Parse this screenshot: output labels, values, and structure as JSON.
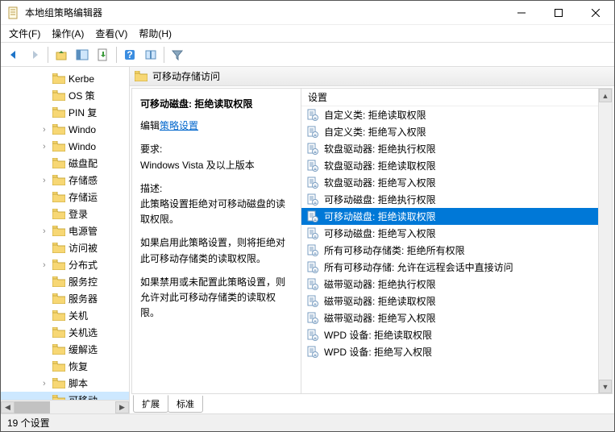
{
  "window": {
    "title": "本地组策略编辑器"
  },
  "menu": {
    "file": "文件(F)",
    "action": "操作(A)",
    "view": "查看(V)",
    "help": "帮助(H)"
  },
  "tree": {
    "items": [
      {
        "label": "Kerbe"
      },
      {
        "label": "OS 策"
      },
      {
        "label": "PIN 复"
      },
      {
        "label": "Windo",
        "toggle": true
      },
      {
        "label": "Windo",
        "toggle": true
      },
      {
        "label": "磁盘配"
      },
      {
        "label": "存储感",
        "toggle": true
      },
      {
        "label": "存储运"
      },
      {
        "label": "登录"
      },
      {
        "label": "电源管",
        "toggle": true
      },
      {
        "label": "访问被"
      },
      {
        "label": "分布式",
        "toggle": true
      },
      {
        "label": "服务控"
      },
      {
        "label": "服务器"
      },
      {
        "label": "关机"
      },
      {
        "label": "关机选"
      },
      {
        "label": "缓解选"
      },
      {
        "label": "恢复"
      },
      {
        "label": "脚本",
        "toggle": true
      },
      {
        "label": "可移动",
        "selected": true
      }
    ]
  },
  "header": {
    "title": "可移动存储访问"
  },
  "desc": {
    "title": "可移动磁盘: 拒绝读取权限",
    "edit_prefix": "编辑",
    "edit_link": "策略设置",
    "req_label": "要求:",
    "req_body": "Windows Vista 及以上版本",
    "desc_label": "描述:",
    "desc_body": "此策略设置拒绝对可移动磁盘的读取权限。",
    "p2": "如果启用此策略设置，则将拒绝对此可移动存储类的读取权限。",
    "p3": "如果禁用或未配置此策略设置，则允许对此可移动存储类的读取权限。"
  },
  "list": {
    "col": "设置",
    "items": [
      {
        "label": "自定义类: 拒绝读取权限"
      },
      {
        "label": "自定义类: 拒绝写入权限"
      },
      {
        "label": "软盘驱动器: 拒绝执行权限"
      },
      {
        "label": "软盘驱动器: 拒绝读取权限"
      },
      {
        "label": "软盘驱动器: 拒绝写入权限"
      },
      {
        "label": "可移动磁盘: 拒绝执行权限"
      },
      {
        "label": "可移动磁盘: 拒绝读取权限",
        "selected": true
      },
      {
        "label": "可移动磁盘: 拒绝写入权限"
      },
      {
        "label": "所有可移动存储类: 拒绝所有权限"
      },
      {
        "label": "所有可移动存储: 允许在远程会话中直接访问"
      },
      {
        "label": "磁带驱动器: 拒绝执行权限"
      },
      {
        "label": "磁带驱动器: 拒绝读取权限"
      },
      {
        "label": "磁带驱动器: 拒绝写入权限"
      },
      {
        "label": "WPD 设备: 拒绝读取权限"
      },
      {
        "label": "WPD 设备: 拒绝写入权限"
      }
    ]
  },
  "tabs": {
    "extended": "扩展",
    "standard": "标准"
  },
  "status": "19 个设置"
}
